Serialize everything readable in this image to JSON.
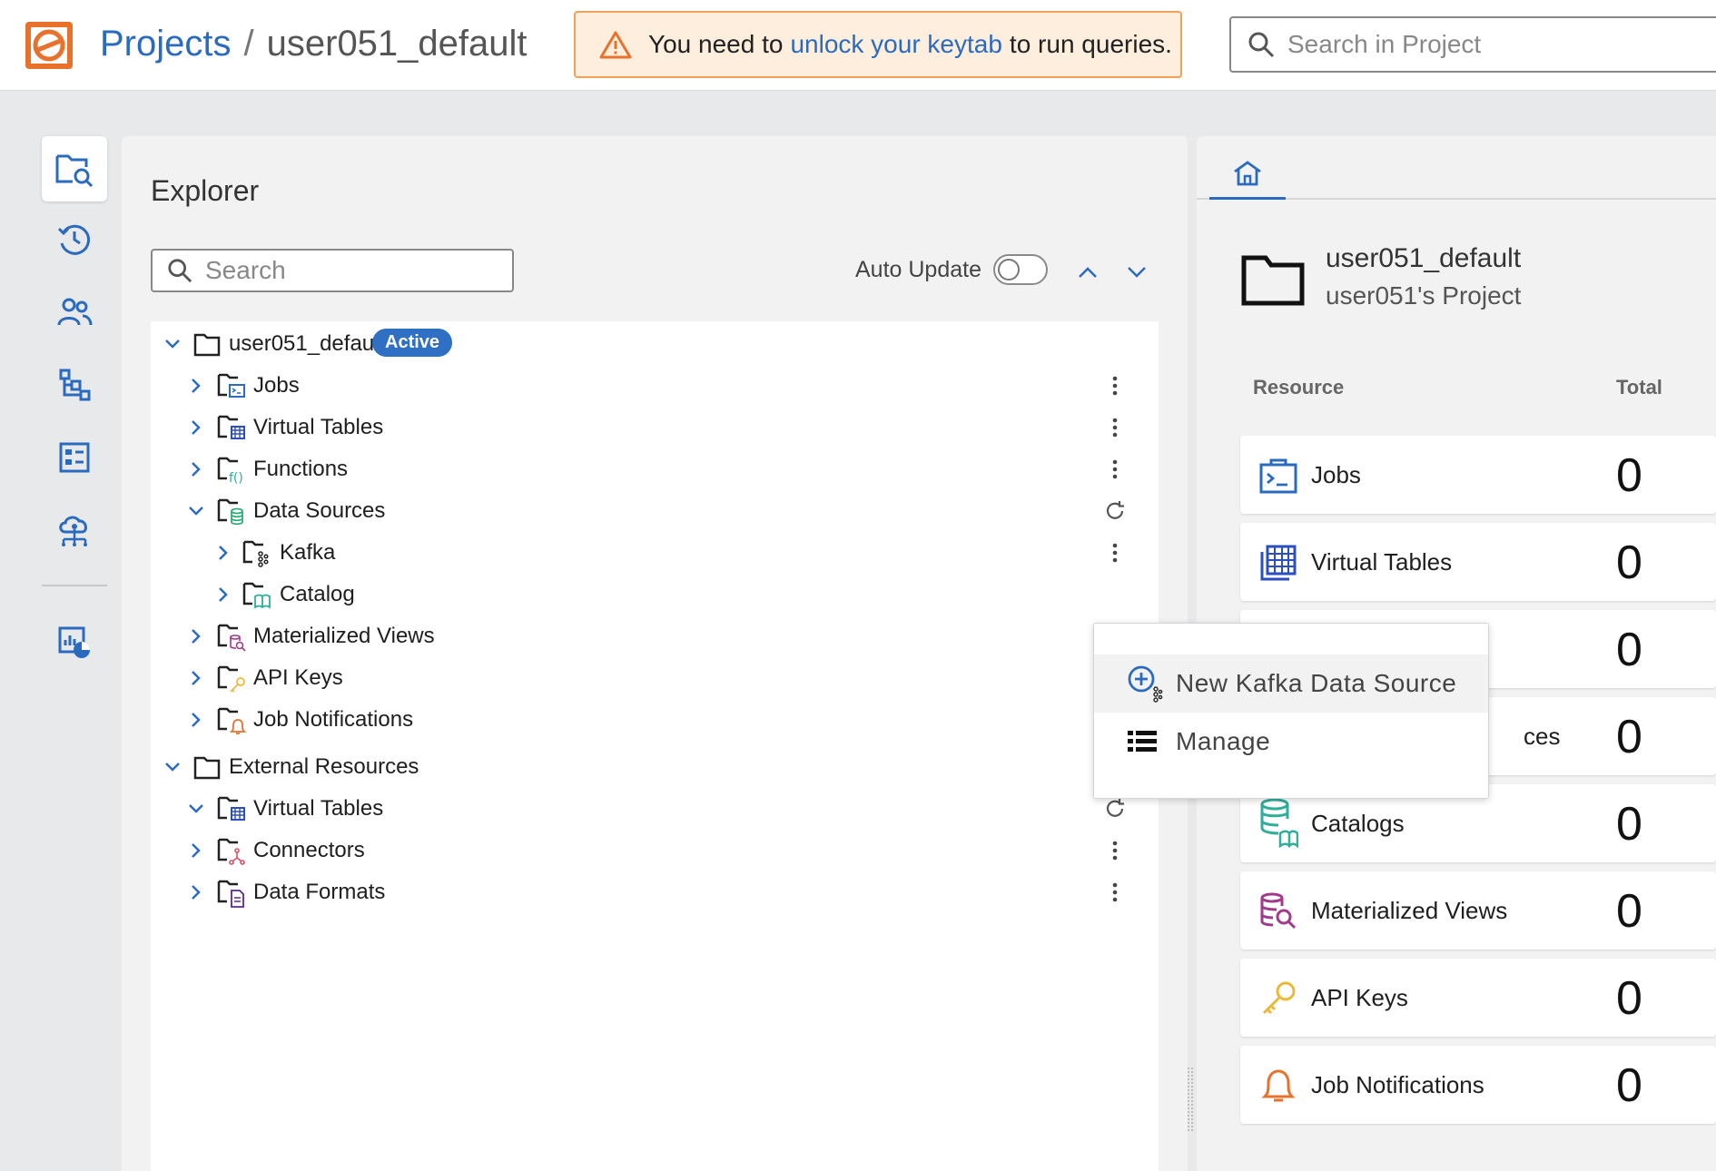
{
  "header": {
    "breadcrumb_root": "Projects",
    "breadcrumb_sep": "/",
    "breadcrumb_current": "user051_default",
    "warning_pre": "You need to",
    "warning_link": "unlock your keytab",
    "warning_post": "to run queries.",
    "search_placeholder": "Search in Project"
  },
  "rail": {
    "items": [
      "explorer",
      "history",
      "users",
      "hierarchy",
      "dashboard",
      "cloud-network",
      "reports"
    ]
  },
  "explorer": {
    "title": "Explorer",
    "search_placeholder": "Search",
    "auto_update_label": "Auto Update",
    "auto_update_on": false,
    "project": {
      "name": "user051_default",
      "badge": "Active"
    },
    "items": [
      {
        "label": "Jobs"
      },
      {
        "label": "Virtual Tables"
      },
      {
        "label": "Functions"
      },
      {
        "label": "Data Sources",
        "children": [
          {
            "label": "Kafka"
          },
          {
            "label": "Catalog"
          }
        ]
      },
      {
        "label": "Materialized Views"
      },
      {
        "label": "API Keys"
      },
      {
        "label": "Job Notifications"
      }
    ],
    "external": {
      "label": "External Resources",
      "items": [
        {
          "label": "Virtual Tables"
        },
        {
          "label": "Connectors"
        },
        {
          "label": "Data Formats"
        }
      ]
    }
  },
  "context_menu": {
    "new_kafka": "New Kafka Data Source",
    "manage": "Manage"
  },
  "overview": {
    "project_name": "user051_default",
    "project_sub": "user051's Project",
    "col_resource": "Resource",
    "col_total": "Total",
    "rows": [
      {
        "label": "Jobs",
        "total": "0"
      },
      {
        "label": "Virtual Tables",
        "total": "0"
      },
      {
        "label": "",
        "total": "0"
      },
      {
        "label": "ces",
        "total": "0"
      },
      {
        "label": "Catalogs",
        "total": "0"
      },
      {
        "label": "Materialized Views",
        "total": "0"
      },
      {
        "label": "API Keys",
        "total": "0"
      },
      {
        "label": "Job Notifications",
        "total": "0"
      }
    ]
  },
  "colors": {
    "accent": "#2b6bbf",
    "logo": "#e8712c",
    "warning_bg": "#fdeedd",
    "warning_border": "#f0a25a",
    "badge": "#2f6fc4"
  }
}
